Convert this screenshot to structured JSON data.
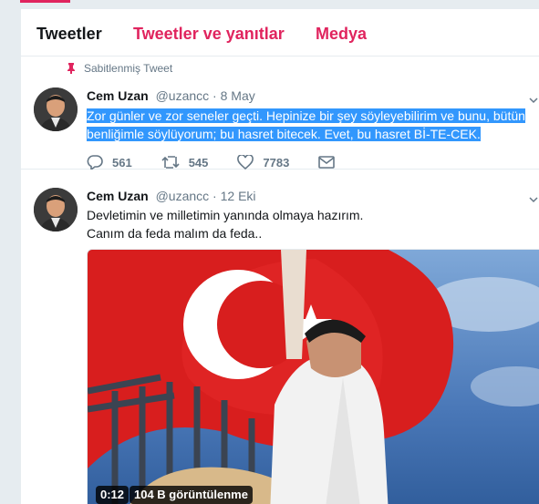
{
  "tabs": [
    {
      "label": "Tweetler",
      "active": true
    },
    {
      "label": "Tweetler ve yanıtlar",
      "active": false
    },
    {
      "label": "Medya",
      "active": false
    }
  ],
  "colors": {
    "accent": "#e0245e",
    "muted": "#657786",
    "highlight": "#3297fd",
    "background": "#e6ecf0"
  },
  "tweets": [
    {
      "pinned_label": "Sabitlenmiş Tweet",
      "name": "Cem Uzan",
      "handle": "@uzancc",
      "separator": "·",
      "time": "8 May",
      "text_line1": "Zor günler ve zor seneler geçti. Hepinize bir şey söyleyebilirim ve bunu, bütün",
      "text_line2": "benliğimle söylüyorum; bu hasret bitecek. Evet, bu hasret Bİ-TE-CEK.",
      "replies": "561",
      "retweets": "545",
      "likes": "7783",
      "icons": [
        "pin-icon",
        "reply-icon",
        "retweet-icon",
        "like-icon",
        "dm-icon",
        "chevron-down-icon"
      ]
    },
    {
      "name": "Cem Uzan",
      "handle": "@uzancc",
      "separator": "·",
      "time": "12 Eki",
      "text_line1": "Devletimin ve milletimin yanında olmaya hazırım.",
      "text_line2": "Canım da feda malım da feda..",
      "video_duration": "0:12",
      "video_views": "104 B görüntülenme",
      "icons": [
        "chevron-down-icon"
      ]
    }
  ]
}
